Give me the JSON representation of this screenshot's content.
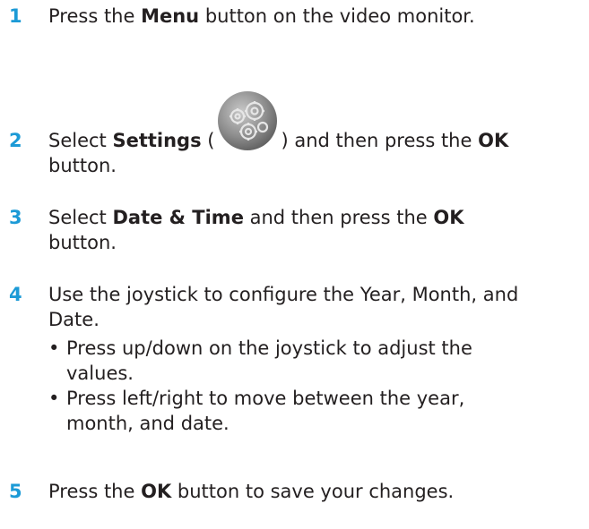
{
  "steps": [
    {
      "number": "1",
      "parts": [
        "Press the ",
        "Menu",
        " button on the video monitor."
      ]
    },
    {
      "number": "2",
      "parts": [
        "Select ",
        "Settings",
        " (",
        ") and then press the ",
        "OK",
        " button."
      ],
      "icon": "settings-gear-icon"
    },
    {
      "number": "3",
      "parts": [
        "Select ",
        "Date & Time",
        " and then press the ",
        "OK",
        " button."
      ]
    },
    {
      "number": "4",
      "text": "Use the joystick to configure the Year, Month, and Date.",
      "bullets": [
        "Press up/down on the joystick to adjust the values.",
        "Press left/right to move between the year, month, and date."
      ],
      "bullet_symbol": "•"
    },
    {
      "number": "5",
      "parts": [
        "Press the ",
        "OK",
        " button to save your changes."
      ]
    }
  ],
  "colors": {
    "step_number": "#1c9ad6",
    "text": "#231f20",
    "icon_base": "#8a8a8a"
  }
}
